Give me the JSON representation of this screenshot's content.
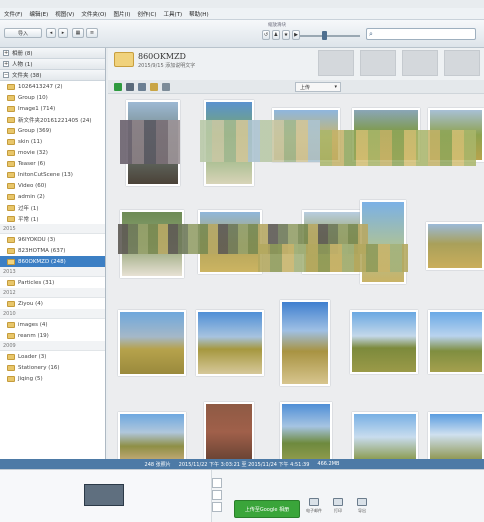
{
  "menu": [
    "文件(F)",
    "编辑(E)",
    "视图(V)",
    "文件夹(O)",
    "图片(I)",
    "创作(C)",
    "工具(T)",
    "帮助(H)"
  ],
  "toolbar": {
    "import_label": "导入",
    "search_placeholder": "",
    "zoom_label": "缩放滑块"
  },
  "sidebar": {
    "sections": [
      {
        "label": "相册 (8)"
      },
      {
        "label": "人物 (1)"
      },
      {
        "label": "文件夹 (38)"
      }
    ],
    "folders_top": [
      {
        "label": "1026413247 (2)"
      },
      {
        "label": "Group (10)"
      },
      {
        "label": "Image1 (714)"
      },
      {
        "label": "新文件夹20161221405 (24)"
      },
      {
        "label": "Group (369)"
      },
      {
        "label": "skin (11)"
      },
      {
        "label": "movie (32)"
      },
      {
        "label": "Teaser (6)"
      },
      {
        "label": "InitonCutScene (13)"
      },
      {
        "label": "Video (60)"
      },
      {
        "label": "admin (2)"
      },
      {
        "label": "过年 (1)"
      },
      {
        "label": "平常 (1)"
      }
    ],
    "year_2015": "2015",
    "folders_2015": [
      {
        "label": "96IYOKOU (3)"
      },
      {
        "label": "823HOTMA (637)"
      },
      {
        "label": "860OKMZD (248)",
        "selected": true
      }
    ],
    "year_2013": "2013",
    "folders_2013": [
      {
        "label": "Particles (31)"
      }
    ],
    "year_2012": "2012",
    "folders_2012": [
      {
        "label": "Ziyou (4)"
      }
    ],
    "year_2010": "2010",
    "folders_2010": [
      {
        "label": "images (4)"
      },
      {
        "label": "reanm (19)"
      }
    ],
    "year_2009": "2009",
    "folders_2009": [
      {
        "label": "Loader (3)"
      },
      {
        "label": "Stationery (16)"
      },
      {
        "label": "Jiqing (5)"
      }
    ]
  },
  "folder_header": {
    "title": "860OKMZD",
    "subtitle": "2015/9/15 添加说明文字"
  },
  "actionbar": {
    "dropdown": "上传"
  },
  "statusbar": {
    "count": "248 张照片",
    "range": "2015/11/22 下午 3:03:21 至 2015/11/24 下午 4:51:39",
    "size": "466.2MB"
  },
  "tray": {
    "share_label": "上传至Google 相册",
    "tools": [
      {
        "label": "电子邮件",
        "icon": "email-icon"
      },
      {
        "label": "打印",
        "icon": "print-icon"
      },
      {
        "label": "导出",
        "icon": "export-icon"
      }
    ]
  },
  "colors": {
    "selection": "#3c7fc4",
    "statusbar": "#4d7aa6",
    "share": "#3aa53a"
  }
}
